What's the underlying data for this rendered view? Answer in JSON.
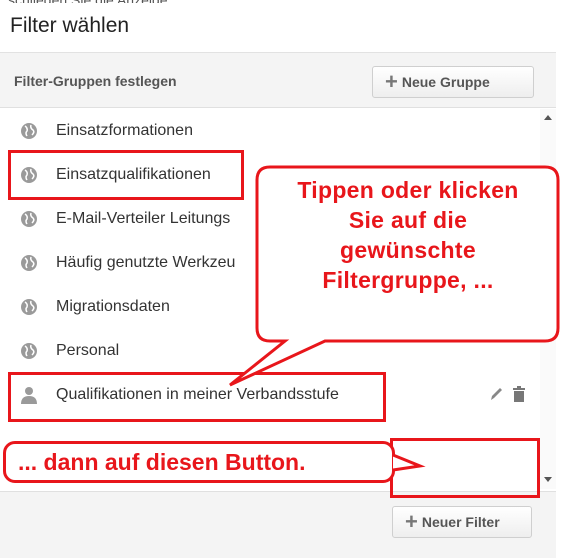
{
  "dialog": {
    "title": "Filter wählen"
  },
  "group_header": {
    "label": "Filter-Gruppen festlegen",
    "new_group_label": "Neue Gruppe"
  },
  "filter_groups": [
    {
      "label": "Einsatzformationen",
      "icon": "globe-icon"
    },
    {
      "label": "Einsatzqualifikationen",
      "icon": "globe-icon"
    },
    {
      "label": "E-Mail-Verteiler Leitungs",
      "icon": "globe-icon"
    },
    {
      "label": "Häufig genutzte Werkzeu",
      "icon": "globe-icon"
    },
    {
      "label": "Migrationsdaten",
      "icon": "globe-icon"
    },
    {
      "label": "Personal",
      "icon": "globe-icon"
    },
    {
      "label": "Qualifikationen in meiner Verbandsstufe",
      "icon": "person-icon"
    }
  ],
  "footer": {
    "new_filter_label": "Neuer Filter"
  },
  "annotations": {
    "callout_lines": [
      "Tippen oder klicken",
      "Sie auf die",
      "gewünschte",
      "Filtergruppe, ..."
    ],
    "bottom_callout": "... dann auf diesen Button."
  },
  "colors": {
    "annotation_red": "#e8161b",
    "header_bg": "#f4f4f4"
  }
}
